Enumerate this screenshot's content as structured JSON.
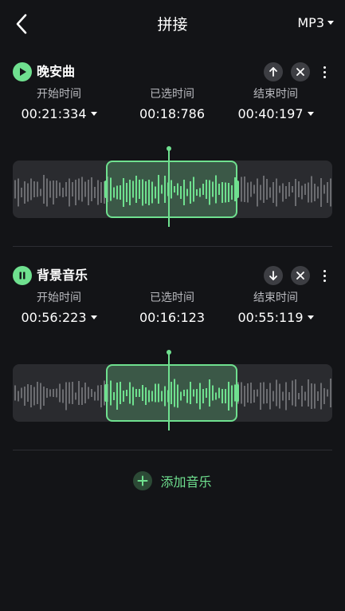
{
  "header": {
    "title": "拼接",
    "format": "MP3"
  },
  "tracks": [
    {
      "name": "晚安曲",
      "playing": false,
      "move_icon": "arrow-up-icon",
      "start_label": "开始时间",
      "start_value": "00:21:334",
      "selected_label": "已选时间",
      "selected_value": "00:18:786",
      "end_label": "结束时间",
      "end_value": "00:40:197"
    },
    {
      "name": "背景音乐",
      "playing": true,
      "move_icon": "arrow-down-icon",
      "start_label": "开始时间",
      "start_value": "00:56:223",
      "selected_label": "已选时间",
      "selected_value": "00:16:123",
      "end_label": "结束时间",
      "end_value": "00:55:119"
    }
  ],
  "add_music": {
    "label": "添加音乐"
  },
  "colors": {
    "accent": "#6fe08f",
    "background": "#131417",
    "panel": "#2a2b2f"
  }
}
